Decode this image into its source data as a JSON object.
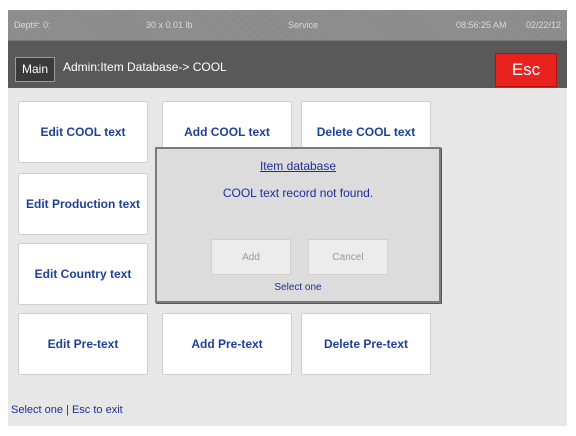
{
  "status_bar": {
    "dept": "Dept#: 0:",
    "weight": "30 x 0.01 lb",
    "mode": "Service",
    "time": "08:56:25 AM",
    "date": "02/22/12"
  },
  "header": {
    "main_label": "Main",
    "breadcrumb": "Admin:Item Database-> COOL",
    "esc_label": "Esc"
  },
  "tiles": {
    "edit_cool": "Edit COOL text",
    "add_cool": "Add COOL text",
    "delete_cool": "Delete COOL text",
    "edit_production": "Edit Production text",
    "edit_country": "Edit Country text",
    "edit_pretext": "Edit Pre-text",
    "add_pretext": "Add Pre-text",
    "delete_pretext": "Delete Pre-text"
  },
  "dialog": {
    "title": "Item database",
    "message": "COOL text record not found.",
    "add_label": "Add",
    "cancel_label": "Cancel",
    "hint": "Select one"
  },
  "footer": {
    "hint": "Select one | Esc to exit"
  },
  "colors": {
    "esc_red": "#e8231f",
    "label_blue": "#1f3f99",
    "title_bar": "#595959"
  }
}
